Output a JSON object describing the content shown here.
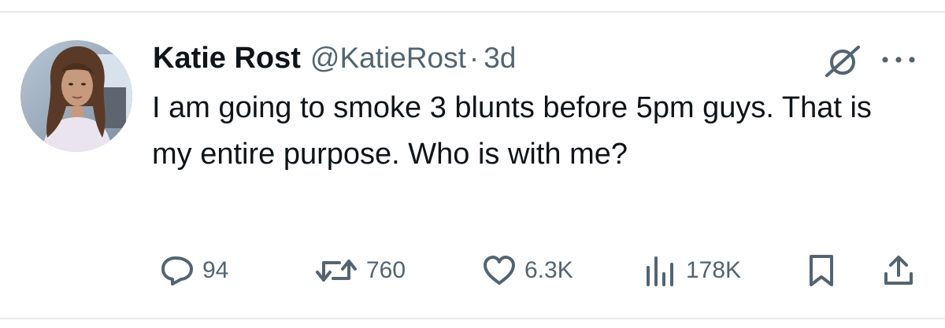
{
  "tweet": {
    "author": {
      "display_name": "Katie Rost",
      "handle": "@KatieRost",
      "separator": "·",
      "time_ago": "3d"
    },
    "text": "I am going to smoke 3 blunts before 5pm guys. That is my entire purpose. Who is with me?",
    "header_icons": [
      "grok-icon",
      "more-icon"
    ]
  },
  "actions": {
    "reply": {
      "icon": "reply-icon",
      "count": "94"
    },
    "retweet": {
      "icon": "retweet-icon",
      "count": "760"
    },
    "like": {
      "icon": "heart-icon",
      "count": "6.3K"
    },
    "views": {
      "icon": "views-icon",
      "count": "178K"
    },
    "bookmark": {
      "icon": "bookmark-icon"
    },
    "share": {
      "icon": "share-icon"
    }
  },
  "colors": {
    "text_primary": "#0f1419",
    "text_secondary": "#536471",
    "divider": "#e6e9eb"
  }
}
